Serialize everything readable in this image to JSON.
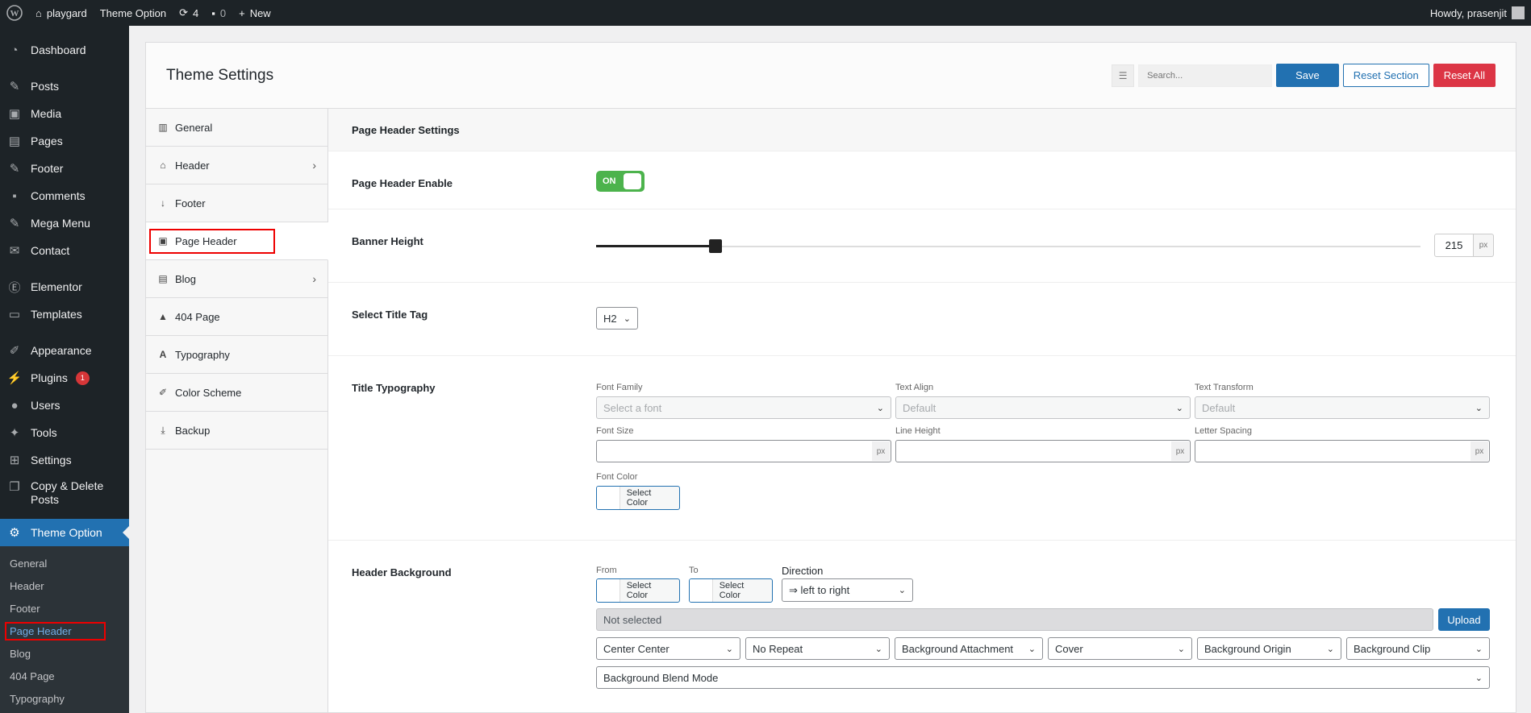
{
  "adminbar": {
    "site_name": "playgard",
    "theme_option": "Theme Option",
    "updates_count": "4",
    "comments_count": "0",
    "new_label": "New",
    "howdy": "Howdy, prasenjit"
  },
  "menu": {
    "items": [
      {
        "label": "Dashboard",
        "icon": "dashboard-icon"
      },
      {
        "label": "Posts",
        "icon": "pin-icon"
      },
      {
        "label": "Media",
        "icon": "media-icon"
      },
      {
        "label": "Pages",
        "icon": "pages-icon"
      },
      {
        "label": "Footer",
        "icon": "pin-icon"
      },
      {
        "label": "Comments",
        "icon": "comment-icon"
      },
      {
        "label": "Mega Menu",
        "icon": "pin-icon"
      },
      {
        "label": "Contact",
        "icon": "mail-icon"
      },
      {
        "label": "Elementor",
        "icon": "elementor-icon"
      },
      {
        "label": "Templates",
        "icon": "folder-icon"
      },
      {
        "label": "Appearance",
        "icon": "brush-icon"
      },
      {
        "label": "Plugins",
        "icon": "plugin-icon",
        "badge": "1"
      },
      {
        "label": "Users",
        "icon": "user-icon"
      },
      {
        "label": "Tools",
        "icon": "wrench-icon"
      },
      {
        "label": "Settings",
        "icon": "settings-icon"
      },
      {
        "label": "Copy & Delete Posts",
        "icon": "copy-icon"
      }
    ],
    "current": {
      "label": "Theme Option",
      "icon": "gear-icon"
    },
    "submenu": [
      "General",
      "Header",
      "Footer",
      "Page Header",
      "Blog",
      "404 Page",
      "Typography"
    ]
  },
  "panel": {
    "title": "Theme Settings",
    "search_placeholder": "Search...",
    "save": "Save",
    "reset_section": "Reset Section",
    "reset_all": "Reset All"
  },
  "tabs": [
    {
      "label": "General",
      "icon": "building-icon"
    },
    {
      "label": "Header",
      "icon": "home-icon",
      "chevron": "›"
    },
    {
      "label": "Footer",
      "icon": "arrow-down-icon"
    },
    {
      "label": "Page Header",
      "icon": "image-icon"
    },
    {
      "label": "Blog",
      "icon": "document-icon",
      "chevron": "›"
    },
    {
      "label": "404 Page",
      "icon": "warning-icon"
    },
    {
      "label": "Typography",
      "icon": "font-icon"
    },
    {
      "label": "Color Scheme",
      "icon": "brush-icon"
    },
    {
      "label": "Backup",
      "icon": "download-icon"
    }
  ],
  "section": {
    "title": "Page Header Settings",
    "page_header_enable": {
      "label": "Page Header Enable",
      "state": "ON"
    },
    "banner_height": {
      "label": "Banner Height",
      "value": "215",
      "unit": "px",
      "fraction": 0.145
    },
    "title_tag": {
      "label": "Select Title Tag",
      "value": "H2"
    },
    "title_typography": {
      "label": "Title Typography",
      "font_family_label": "Font Family",
      "font_family_value": "Select a font",
      "text_align_label": "Text Align",
      "text_align_value": "Default",
      "text_transform_label": "Text Transform",
      "text_transform_value": "Default",
      "font_size_label": "Font Size",
      "line_height_label": "Line Height",
      "letter_spacing_label": "Letter Spacing",
      "unit": "px",
      "font_color_label": "Font Color",
      "select_color": "Select Color"
    },
    "header_background": {
      "label": "Header Background",
      "from_label": "From",
      "to_label": "To",
      "direction_label": "Direction",
      "select_color": "Select Color",
      "direction_value": "⇒ left to right",
      "upload_value": "Not selected",
      "upload_btn": "Upload",
      "position": "Center Center",
      "repeat": "No Repeat",
      "attachment": "Background Attachment",
      "size": "Cover",
      "origin": "Background Origin",
      "clip": "Background Clip",
      "blend": "Background Blend Mode"
    }
  }
}
